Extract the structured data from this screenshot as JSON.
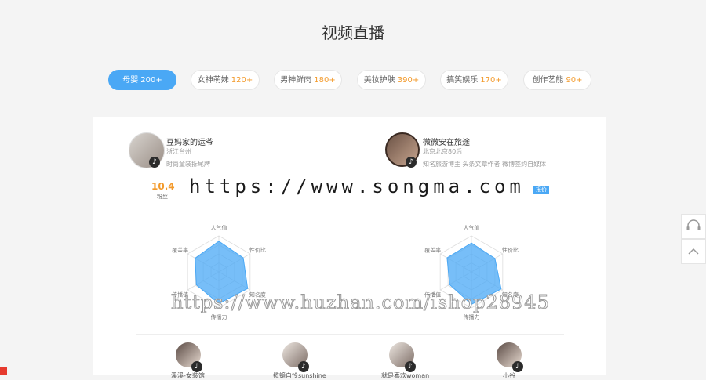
{
  "section": {
    "title": "视频直播"
  },
  "tabs": [
    {
      "label": "母婴",
      "count": "200+",
      "active": true
    },
    {
      "label": "女神萌妹",
      "count": "120+"
    },
    {
      "label": "男神鲜肉",
      "count": "180+"
    },
    {
      "label": "美妆护肤",
      "count": "390+"
    },
    {
      "label": "搞笑娱乐",
      "count": "170+"
    },
    {
      "label": "创作艺能",
      "count": "90+"
    }
  ],
  "influencers": [
    {
      "name": "豆妈家的运爷",
      "location": "浙江台州",
      "desc": "时尚童装拆尾牌",
      "fans_value": "10.4",
      "fans_label": "粉丝",
      "radar": {
        "labels": [
          "人气值",
          "性价比",
          "知名度",
          "传播力",
          "传播值",
          "覆盖率"
        ],
        "values": [
          0.85,
          0.78,
          0.92,
          0.88,
          0.72,
          0.76
        ]
      }
    },
    {
      "name": "微微安在旅途",
      "location": "北京北京80后",
      "desc": "知名旅游博主 头条文章作者 微博签约自媒体",
      "report_label": "报价",
      "radar": {
        "labels": [
          "人气值",
          "性价比",
          "知名度",
          "传播力",
          "传播值",
          "覆盖率"
        ],
        "values": [
          0.8,
          0.75,
          0.95,
          0.9,
          0.7,
          0.78
        ]
      }
    }
  ],
  "small_influencers": [
    {
      "name": "溪溪-女装馆"
    },
    {
      "name": "揽镜自怜sunshine"
    },
    {
      "name": "就是喜欢woman"
    },
    {
      "name": "小谷"
    }
  ],
  "watermarks": {
    "top": "https://www.songma.com",
    "bottom": "https://www.huzhan.com/ishop28945"
  },
  "icons": {
    "support": "headset-icon",
    "top": "chevron-up-icon",
    "avatar_badge": "douyin-icon"
  },
  "colors": {
    "accent": "#4aa8f5",
    "count": "#f39a2b",
    "radar_fill": "#4aa8f5"
  }
}
